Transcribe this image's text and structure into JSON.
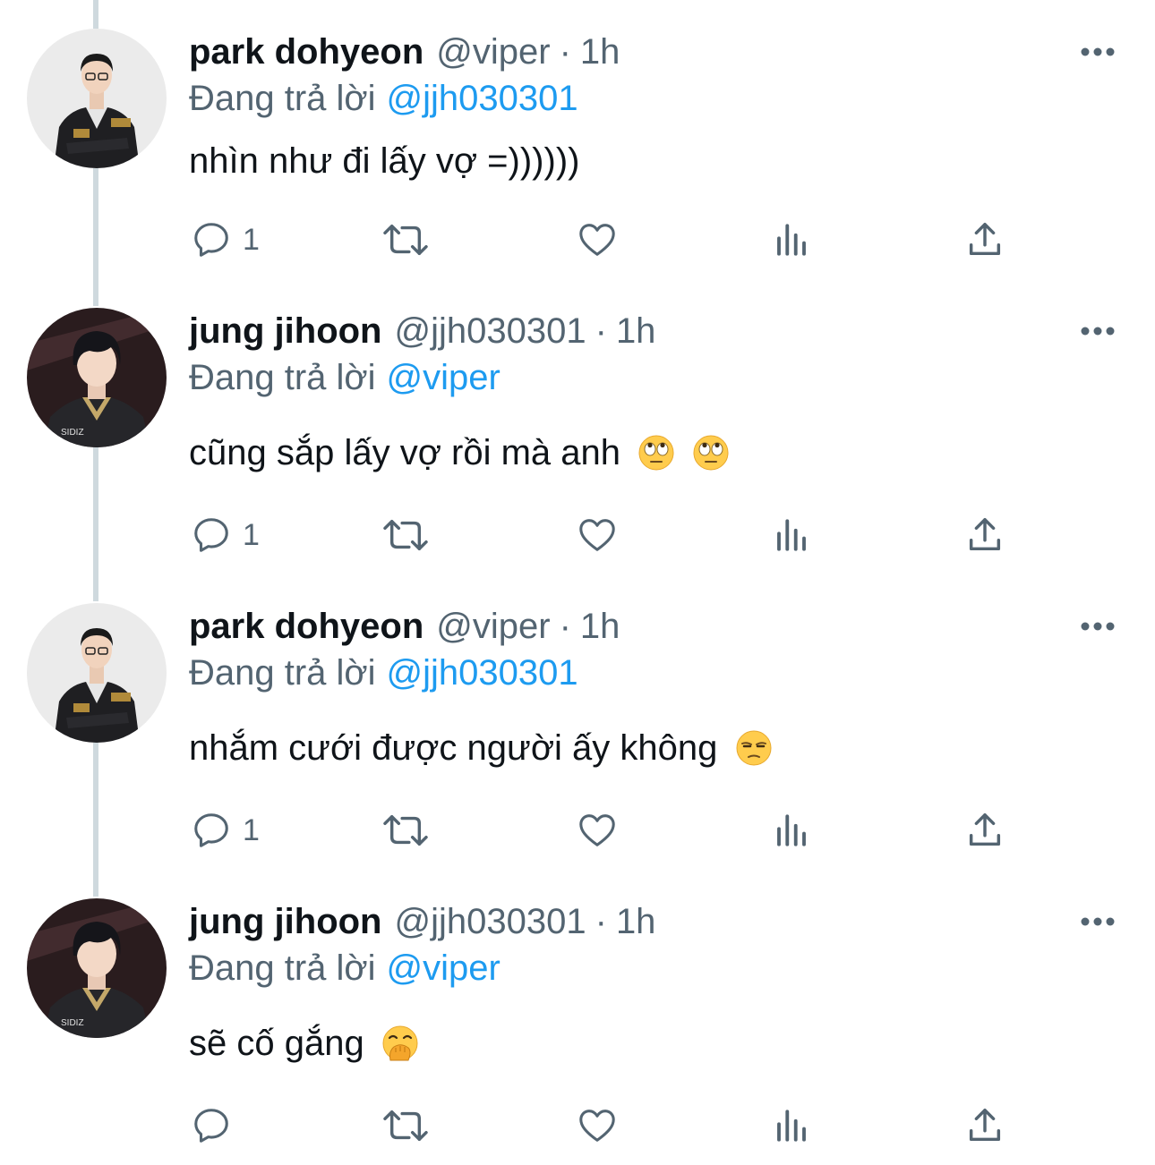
{
  "tweets": [
    {
      "name": "park dohyeon",
      "handle": "@viper",
      "separator": "·",
      "time": "1h",
      "reply_prefix": "Đang trả lời",
      "reply_to": "@jjh030301",
      "text": "nhìn như đi lấy vợ =))))))",
      "emojis": [],
      "reply_count": "1",
      "avatar": "park-dohyeon-avatar"
    },
    {
      "name": "jung jihoon",
      "handle": "@jjh030301",
      "separator": "·",
      "time": "1h",
      "reply_prefix": "Đang trả lời",
      "reply_to": "@viper",
      "text": "cũng sắp lấy vợ rồi mà anh",
      "emojis": [
        "rolling-eyes-emoji",
        "rolling-eyes-emoji"
      ],
      "reply_count": "1",
      "avatar": "jung-jihoon-avatar"
    },
    {
      "name": "park dohyeon",
      "handle": "@viper",
      "separator": "·",
      "time": "1h",
      "reply_prefix": "Đang trả lời",
      "reply_to": "@jjh030301",
      "text": "nhắm cưới được người ấy không",
      "emojis": [
        "unamused-face-emoji"
      ],
      "reply_count": "1",
      "avatar": "park-dohyeon-avatar"
    },
    {
      "name": "jung jihoon",
      "handle": "@jjh030301",
      "separator": "·",
      "time": "1h",
      "reply_prefix": "Đang trả lời",
      "reply_to": "@viper",
      "text": "sẽ cố gắng",
      "emojis": [
        "hand-over-mouth-emoji"
      ],
      "reply_count": "",
      "avatar": "jung-jihoon-avatar"
    }
  ],
  "icons": {
    "reply": "reply-icon",
    "retweet": "retweet-icon",
    "like": "heart-icon",
    "views": "views-icon",
    "share": "share-icon",
    "more": "more-options-icon"
  },
  "colors": {
    "text": "#0f1419",
    "secondary": "#536471",
    "link": "#1d9bf0",
    "thread_line": "#cfd9de",
    "background": "#ffffff"
  }
}
